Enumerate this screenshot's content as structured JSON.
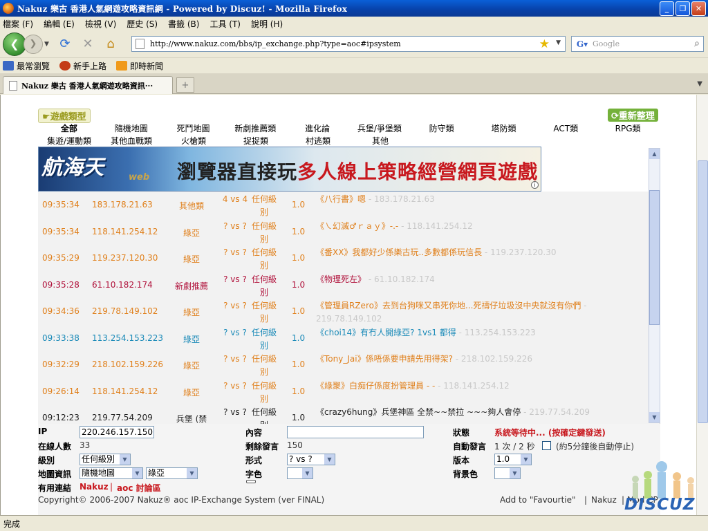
{
  "window": {
    "title": "Nakuz 樂古 香港人氣網遊攻略資訊網 - Powered by Discuz! - Mozilla Firefox"
  },
  "menu": [
    "檔案 (F)",
    "編輯 (E)",
    "檢視 (V)",
    "歷史 (S)",
    "書籤 (B)",
    "工具 (T)",
    "說明 (H)"
  ],
  "nav": {
    "url": "http://www.nakuz.com/bbs/ip_exchange.php?type=aoc#ipsystem",
    "search_placeholder": "Google"
  },
  "bookmarks": [
    "最常瀏覽",
    "新手上路",
    "即時新聞"
  ],
  "tab": {
    "title": "Nakuz 樂古 香港人氣網遊攻略資訊···"
  },
  "page": {
    "game_type_label": "遊戲類型",
    "refresh_label": "重新整理",
    "categories_row1": [
      "全部",
      "隨機地圖",
      "死鬥地圖",
      "新劇推薦類",
      "進化論",
      "兵堡/爭堡類",
      "防守類",
      "塔防類",
      "ACT類",
      "RPG類"
    ],
    "categories_row2": [
      "集遊/運動類",
      "其他血戰類",
      "火槍類",
      "捉捉類",
      "村逃類",
      "其他"
    ],
    "ad": {
      "logo": "航海天",
      "web": "web",
      "headline_a": "瀏覽器直接玩",
      "headline_b": "多人線上策略經營網頁遊戲"
    },
    "log": [
      {
        "time": "09:35:34",
        "ip": "183.178.21.63",
        "map": "其他類",
        "vs": "4 vs 4",
        "level": "任何級別",
        "ver": "1.0",
        "user": "《八行書》",
        "text": "嗯",
        "src": "- 183.178.21.63",
        "color": "#e0801c"
      },
      {
        "time": "09:35:34",
        "ip": "118.141.254.12",
        "map": "綠亞",
        "vs": "? vs ?",
        "level": "任何級別",
        "ver": "1.0",
        "user": "《㇏幻滅♂ｒａｙ》",
        "text": "-.-",
        "src": "- 118.141.254.12",
        "color": "#e0801c"
      },
      {
        "time": "09:35:29",
        "ip": "119.237.120.30",
        "map": "綠亞",
        "vs": "? vs ?",
        "level": "任何級別",
        "ver": "1.0",
        "user": "《番XX》",
        "text": "我都好少係樂古玩..多數都係玩信長",
        "src": "- 119.237.120.30",
        "color": "#e0801c"
      },
      {
        "time": "09:35:28",
        "ip": "61.10.182.174",
        "map": "新劇推薦",
        "vs": "? vs ?",
        "level": "任何級別",
        "ver": "1.0",
        "user": "《物理死左》",
        "text": "",
        "src": "- 61.10.182.174",
        "color": "#b0103a"
      },
      {
        "time": "09:34:36",
        "ip": "219.78.149.102",
        "map": "綠亞",
        "vs": "? vs ?",
        "level": "任何級別",
        "ver": "1.0",
        "user": "《管理員RZero》",
        "text": "去到台狗咪又串死你地...死禱仔垃圾沒中央就沒有你們",
        "src": "- 219.78.149.102",
        "color": "#e0801c"
      },
      {
        "time": "09:33:38",
        "ip": "113.254.153.223",
        "map": "綠亞",
        "vs": "? vs ?",
        "level": "任何級別",
        "ver": "1.0",
        "user": "《choi14》",
        "text": "有冇人開綠亞? 1vs1 都得",
        "src": "- 113.254.153.223",
        "color": "#1a8ab8"
      },
      {
        "time": "09:32:29",
        "ip": "218.102.159.226",
        "map": "綠亞",
        "vs": "? vs ?",
        "level": "任何級別",
        "ver": "1.0",
        "user": "《Tony_Jai》",
        "text": "係唔係要申請先用得架?",
        "src": "- 218.102.159.226",
        "color": "#e0801c"
      },
      {
        "time": "09:26:14",
        "ip": "118.141.254.12",
        "map": "綠亞",
        "vs": "? vs ?",
        "level": "任何級別",
        "ver": "1.0",
        "user": "《綠聚》",
        "text": "白痴仔係度扮管理員 - -",
        "src": "- 118.141.254.12",
        "color": "#e0801c"
      },
      {
        "time": "09:12:23",
        "ip": "219.77.54.209",
        "map": "兵堡 (禁拉)",
        "vs": "? vs ?",
        "level": "任何級別",
        "ver": "1.0",
        "user": "《crazy6hung》",
        "text": "兵堡神區 全禁~~禁拉 ~~~夠人會停",
        "src": "- 219.77.54.209",
        "color": "#222222"
      }
    ],
    "form": {
      "ip_label": "IP",
      "ip_value": "220.246.157.150",
      "content_label": "內容",
      "content_value": "",
      "status_label": "狀態",
      "status_value": "系統等待中... (按確定鍵發送)",
      "online_label": "在線人數",
      "online_value": "33",
      "remaining_label": "剩餘發言",
      "remaining_value": "150",
      "auto_label": "自動發言",
      "auto_value": "1 次 / 2 秒",
      "auto_note": "(約5分鐘後自動停止)",
      "level_label": "級別",
      "level_value": "任何級別",
      "form_label": "形式",
      "form_value": "? vs ?",
      "version_label": "版本",
      "version_value": "1.0",
      "map_label": "地圖資訊",
      "map_value1": "隨機地圖",
      "map_value2": "綠亞",
      "fontcolor_label": "字色",
      "bgcolor_label": "背景色",
      "links_label": "有用連結",
      "link1": "Nakuz",
      "link_sep": "|",
      "link2": "aoc 討論區",
      "copyright": "Copyright© 2006-2007  Nakuz® aoc IP-Exchange System (ver FINAL)",
      "add_fav": "Add to \"Favourtie\"",
      "footer_sep": "|",
      "footer_nakuz": "Nakuz",
      "footer_sep2": "|",
      "footer_modcp": "Mod CP"
    },
    "discuz": "DISCUZ"
  },
  "status": "完成",
  "colors": {
    "link_red": "#c8181e",
    "status_red": "#c8181e",
    "xp_blue": "#0a5fd8"
  }
}
